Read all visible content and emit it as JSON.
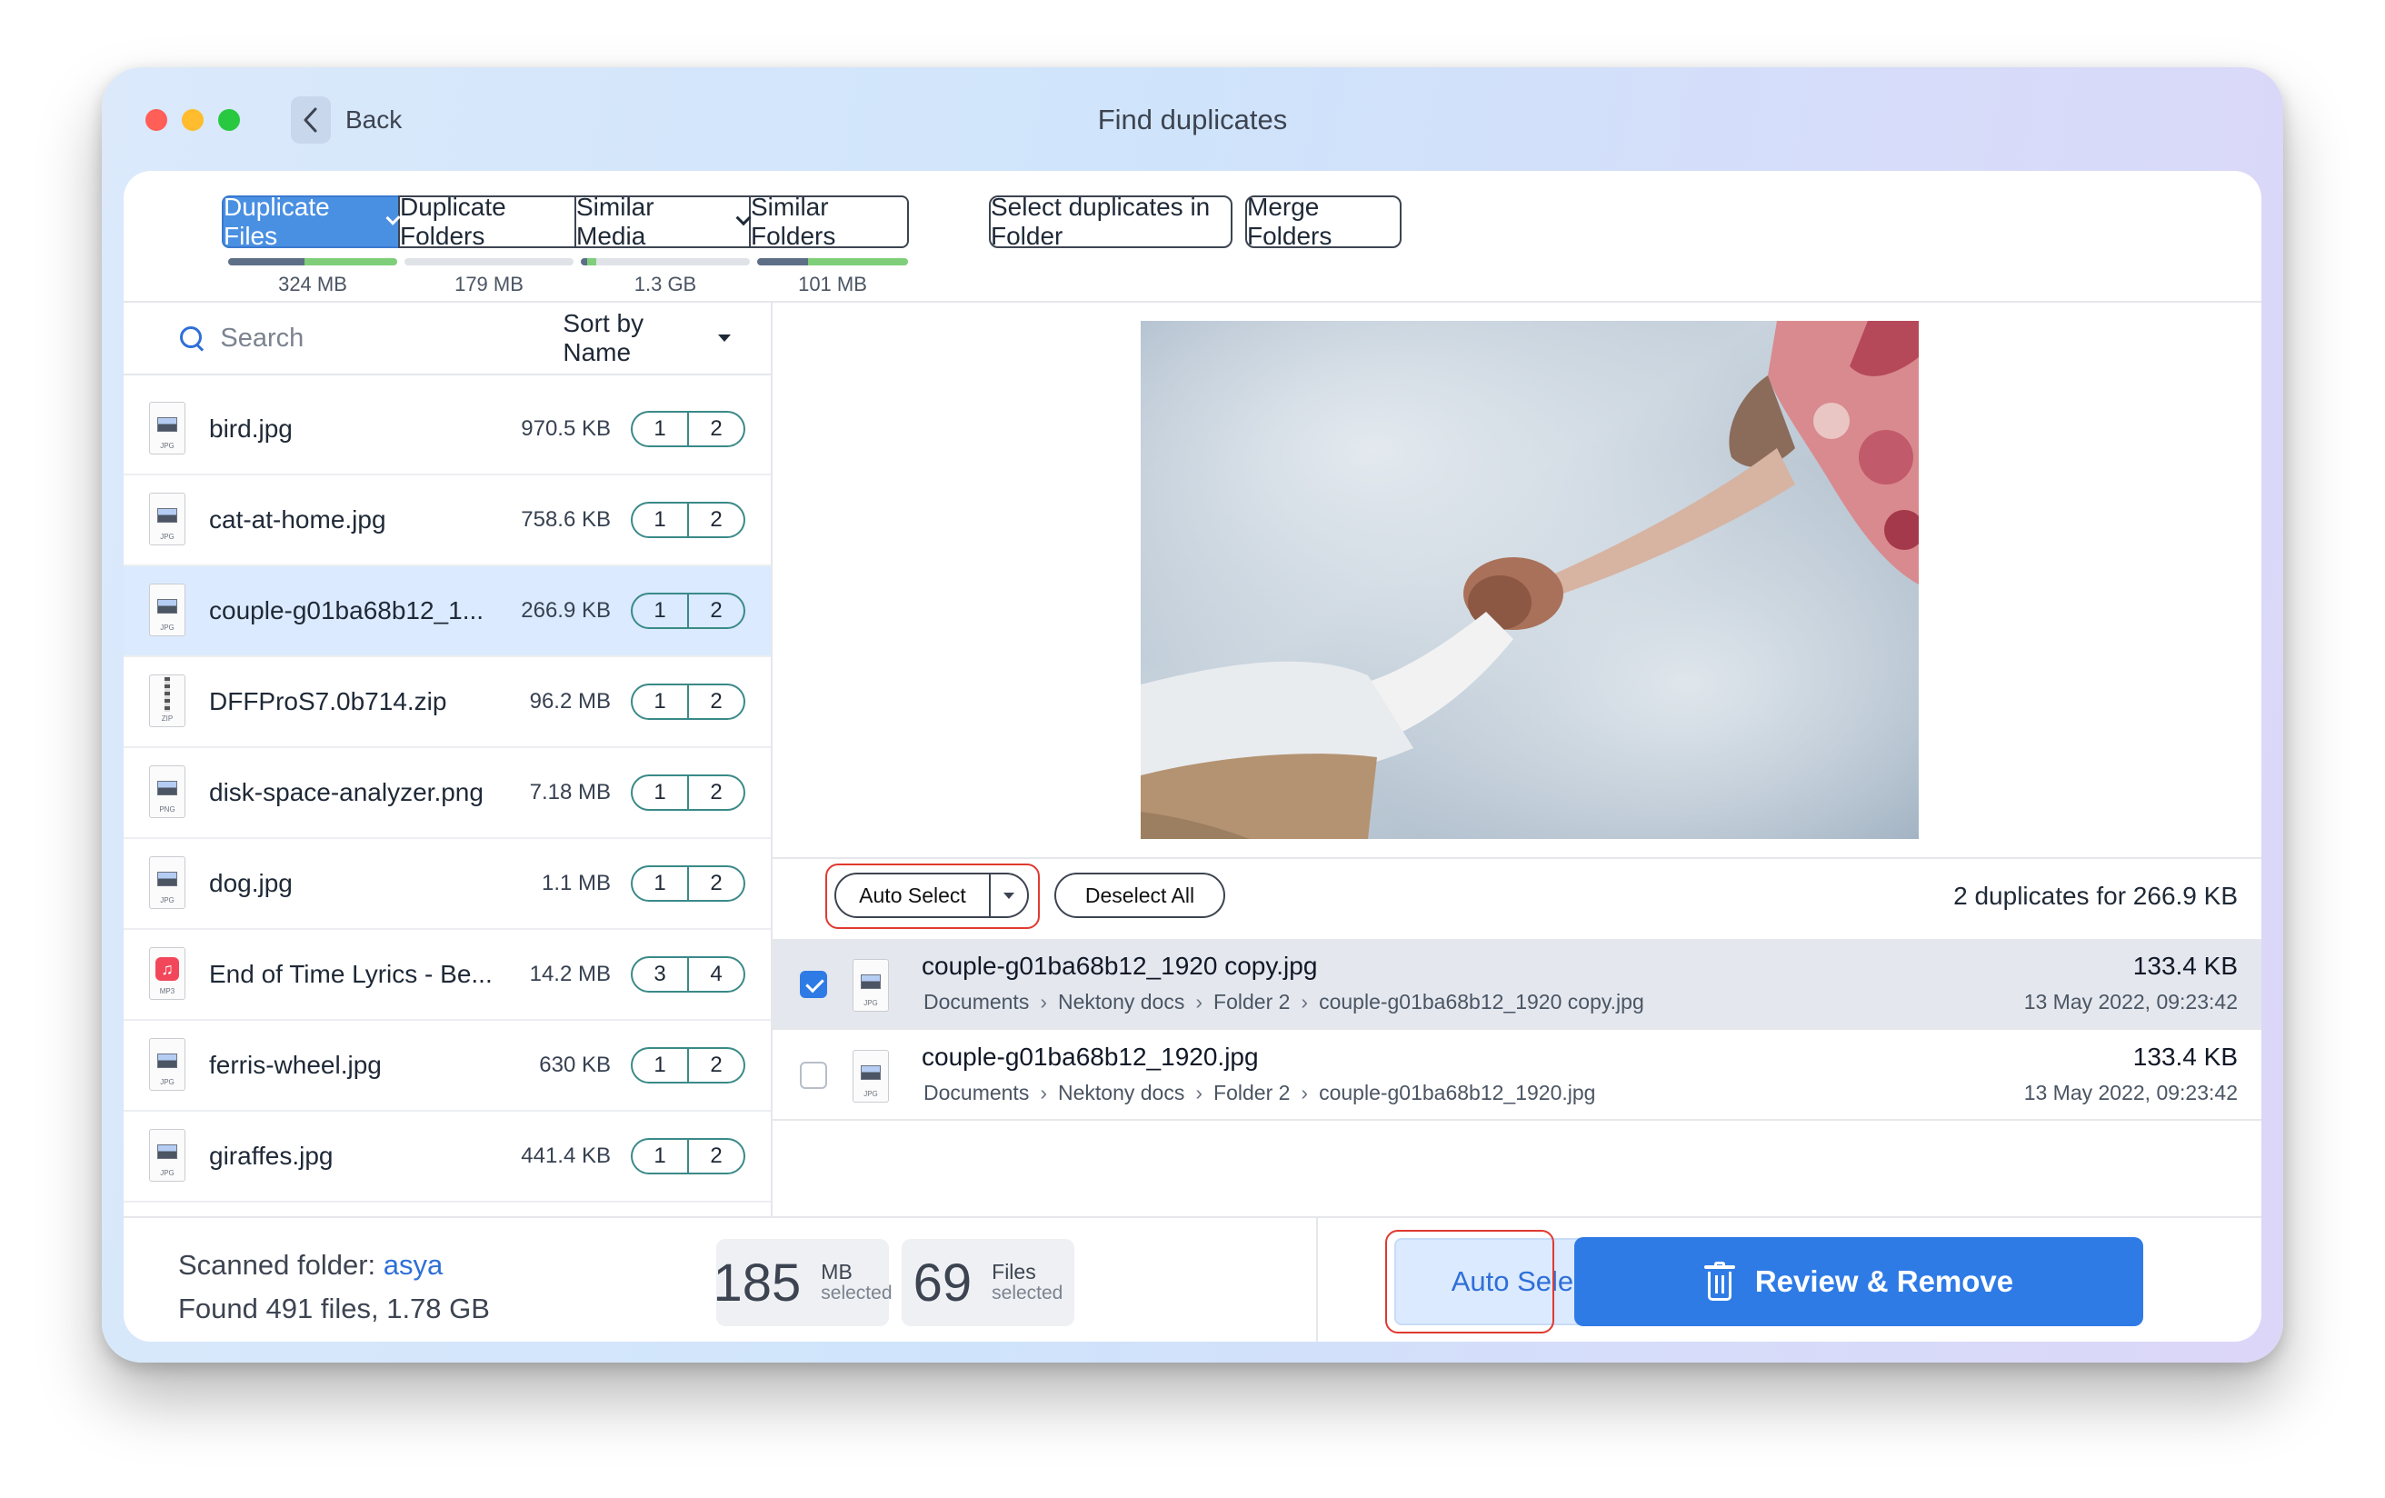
{
  "window": {
    "title": "Find duplicates",
    "back_label": "Back"
  },
  "tabs": [
    {
      "label": "Duplicate Files",
      "size": "324 MB",
      "active": true,
      "dropdown": true
    },
    {
      "label": "Duplicate Folders",
      "size": "179 MB",
      "active": false,
      "dropdown": false
    },
    {
      "label": "Similar Media",
      "size": "1.3 GB",
      "active": false,
      "dropdown": true
    },
    {
      "label": "Similar Folders",
      "size": "101 MB",
      "active": false,
      "dropdown": false
    }
  ],
  "header_buttons": {
    "select_in_folder": "Select duplicates in Folder",
    "merge_folders": "Merge Folders"
  },
  "search": {
    "placeholder": "Search",
    "sort_label": "Sort by Name"
  },
  "files": [
    {
      "name": "bird.jpg",
      "size": "970.5 KB",
      "counts": [
        "1",
        "2"
      ],
      "ext": "JPG",
      "kind": "image"
    },
    {
      "name": "cat-at-home.jpg",
      "size": "758.6 KB",
      "counts": [
        "1",
        "2"
      ],
      "ext": "JPG",
      "kind": "image"
    },
    {
      "name": "couple-g01ba68b12_1...",
      "size": "266.9 KB",
      "counts": [
        "1",
        "2"
      ],
      "ext": "JPG",
      "kind": "image",
      "selected": true
    },
    {
      "name": "DFFProS7.0b714.zip",
      "size": "96.2 MB",
      "counts": [
        "1",
        "2"
      ],
      "ext": "ZIP",
      "kind": "zip"
    },
    {
      "name": "disk-space-analyzer.png",
      "size": "7.18 MB",
      "counts": [
        "1",
        "2"
      ],
      "ext": "PNG",
      "kind": "image"
    },
    {
      "name": "dog.jpg",
      "size": "1.1 MB",
      "counts": [
        "1",
        "2"
      ],
      "ext": "JPG",
      "kind": "image"
    },
    {
      "name": "End of Time Lyrics - Be...",
      "size": "14.2 MB",
      "counts": [
        "3",
        "4"
      ],
      "ext": "MP3",
      "kind": "music"
    },
    {
      "name": "ferris-wheel.jpg",
      "size": "630 KB",
      "counts": [
        "1",
        "2"
      ],
      "ext": "JPG",
      "kind": "image"
    },
    {
      "name": "giraffes.jpg",
      "size": "441.4 KB",
      "counts": [
        "1",
        "2"
      ],
      "ext": "JPG",
      "kind": "image"
    }
  ],
  "duplicates_toolbar": {
    "auto_select": "Auto Select",
    "deselect_all": "Deselect All",
    "summary": "2 duplicates for 266.9 KB"
  },
  "duplicates": [
    {
      "name": "couple-g01ba68b12_1920 copy.jpg",
      "path": [
        "Documents",
        "Nektony docs",
        "Folder 2",
        "couple-g01ba68b12_1920 copy.jpg"
      ],
      "size": "133.4 KB",
      "date": "13 May 2022, 09:23:42",
      "checked": true
    },
    {
      "name": "couple-g01ba68b12_1920.jpg",
      "path": [
        "Documents",
        "Nektony docs",
        "Folder 2",
        "couple-g01ba68b12_1920.jpg"
      ],
      "size": "133.4 KB",
      "date": "13 May 2022, 09:23:42",
      "checked": false
    }
  ],
  "footer": {
    "scanned_prefix": "Scanned folder: ",
    "scanned_folder": "asya",
    "found": "Found 491 files, 1.78 GB",
    "mb_value": "185",
    "mb_unit": "MB",
    "mb_sub": "selected",
    "files_value": "69",
    "files_unit": "Files",
    "files_sub": "selected",
    "auto_select": "Auto Select",
    "review_remove": "Review & Remove"
  },
  "colors": {
    "accent": "#2f7be6",
    "highlight": "#e03a2f",
    "tab_active": "#4a90e2"
  }
}
